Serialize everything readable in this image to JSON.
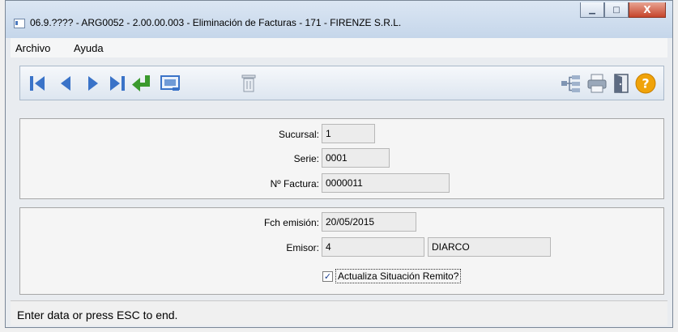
{
  "window": {
    "title": "06.9.???? - ARG0052 - 2.00.00.003 - Eliminación de Facturas - 171 - FIRENZE S.R.L.",
    "controls": {
      "minimize": "▁",
      "maximize": "□",
      "close": "X"
    }
  },
  "menu": {
    "items": [
      "Archivo",
      "Ayuda"
    ]
  },
  "toolbar": {
    "buttons": [
      "first-record",
      "previous-record",
      "next-record",
      "last-record",
      "enter",
      "preview",
      "delete",
      "tree",
      "print",
      "exit",
      "help"
    ],
    "help_label": "?"
  },
  "form": {
    "sucursal": {
      "label": "Sucursal:",
      "value": "1"
    },
    "serie": {
      "label": "Serie:",
      "value": "0001"
    },
    "factura": {
      "label": "Nº Factura:",
      "value": "0000011"
    },
    "fecha": {
      "label": "Fch emisión:",
      "value": "20/05/2015"
    },
    "emisor": {
      "label": "Emisor:",
      "code": "4",
      "name": "DIARCO"
    },
    "actualiza": {
      "label": "Actualiza Situación Remito?",
      "checked": true,
      "mark": "✓"
    }
  },
  "status": {
    "text": "Enter data or press ESC to end."
  },
  "colors": {
    "nav_blue": "#3a73c8",
    "enter_green": "#3b9a2e",
    "help_orange": "#f0a30a"
  }
}
